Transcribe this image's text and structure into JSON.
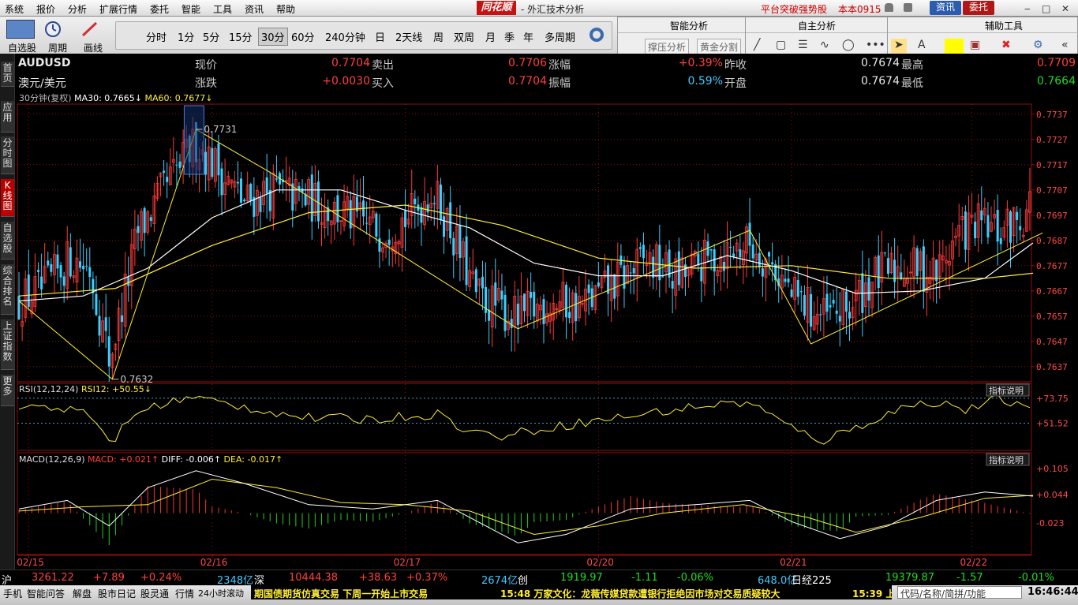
{
  "menubar": {
    "items": [
      "系统",
      "报价",
      "分析",
      "扩展行情",
      "委托",
      "智能",
      "工具",
      "资讯",
      "帮助"
    ],
    "logo": "同花顺",
    "app_title": "- 外汇技术分析",
    "promo": "平台突破强势股",
    "version": "本本0915",
    "news_btn": "资讯",
    "trade_btn": "委托"
  },
  "toolbar": {
    "groups": [
      "自选股",
      "周期",
      "画线"
    ],
    "periods": [
      "分时",
      "1分",
      "5分",
      "15分",
      "30分",
      "60分",
      "240分钟",
      "日",
      "2天线",
      "周",
      "双周",
      "月",
      "季",
      "年",
      "多周期"
    ],
    "selected_period": "30分"
  },
  "analysis_panel": {
    "headers": [
      "智能分析",
      "自主分析",
      "辅助工具"
    ],
    "buttons": [
      "撑压分析",
      "黄金分割"
    ]
  },
  "left_tabs": [
    {
      "label": "首页",
      "active": false
    },
    {
      "label": "应用",
      "active": false
    },
    {
      "label": "分时图",
      "active": false
    },
    {
      "label": "K线图",
      "active": true
    },
    {
      "label": "自选股",
      "active": false
    },
    {
      "label": "综合排名",
      "active": false
    },
    {
      "label": "上证指数",
      "active": false
    },
    {
      "label": "更多",
      "active": false
    }
  ],
  "quote": {
    "symbol": "AUDUSD",
    "name": "澳元/美元",
    "fields": [
      {
        "label": "现价",
        "value": "0.7704",
        "color": "red"
      },
      {
        "label": "涨跌",
        "value": "+0.0030",
        "color": "red"
      },
      {
        "label": "卖出",
        "value": "0.7706",
        "color": "red"
      },
      {
        "label": "买入",
        "value": "0.7704",
        "color": "red"
      },
      {
        "label": "涨幅",
        "value": "+0.39%",
        "color": "red"
      },
      {
        "label": "振幅",
        "value": "0.59%",
        "color": "cyn"
      },
      {
        "label": "昨收",
        "value": "0.7674",
        "color": "w"
      },
      {
        "label": "开盘",
        "value": "0.7674",
        "color": "w"
      },
      {
        "label": "最高",
        "value": "0.7709",
        "color": "red"
      },
      {
        "label": "最低",
        "value": "0.7664",
        "color": "grn"
      }
    ]
  },
  "chart_data": {
    "type": "candlestick",
    "period_label": "30分钟(复权)",
    "ma_legend": [
      {
        "label": "MA30: 0.7665",
        "color": "#ffffff"
      },
      {
        "label": "MA60: 0.7677",
        "color": "#ffee33"
      }
    ],
    "y_ticks": [
      0.7737,
      0.7727,
      0.7717,
      0.7707,
      0.7697,
      0.7687,
      0.7677,
      0.7667,
      0.7657,
      0.7647,
      0.7637
    ],
    "ylim": [
      0.7631,
      0.7741
    ],
    "x_labels": [
      {
        "label": "02/15",
        "index": 3
      },
      {
        "label": "02/16",
        "index": 60
      },
      {
        "label": "02/17",
        "index": 120
      },
      {
        "label": "02/20",
        "index": 180
      },
      {
        "label": "02/21",
        "index": 240
      },
      {
        "label": "02/22",
        "index": 296
      }
    ],
    "bar_count": 315,
    "high_annotation": {
      "label": "0.7731",
      "value": 0.7731,
      "index": 55
    },
    "low_annotation": {
      "label": "0.7632",
      "value": 0.7632,
      "index": 29
    },
    "zigzag": [
      {
        "i": 0,
        "v": 0.7663
      },
      {
        "i": 29,
        "v": 0.7632
      },
      {
        "i": 55,
        "v": 0.7731
      },
      {
        "i": 78,
        "v": 0.7714
      },
      {
        "i": 155,
        "v": 0.7652
      },
      {
        "i": 227,
        "v": 0.7691
      },
      {
        "i": 246,
        "v": 0.7646
      },
      {
        "i": 318,
        "v": 0.769
      }
    ],
    "close_path": [
      {
        "i": 0,
        "v": 0.7663
      },
      {
        "i": 8,
        "v": 0.7668
      },
      {
        "i": 16,
        "v": 0.768
      },
      {
        "i": 22,
        "v": 0.7676
      },
      {
        "i": 28,
        "v": 0.764
      },
      {
        "i": 31,
        "v": 0.7655
      },
      {
        "i": 37,
        "v": 0.769
      },
      {
        "i": 45,
        "v": 0.7707
      },
      {
        "i": 52,
        "v": 0.772
      },
      {
        "i": 55,
        "v": 0.7726
      },
      {
        "i": 62,
        "v": 0.7715
      },
      {
        "i": 70,
        "v": 0.7702
      },
      {
        "i": 78,
        "v": 0.7707
      },
      {
        "i": 90,
        "v": 0.7703
      },
      {
        "i": 100,
        "v": 0.7698
      },
      {
        "i": 112,
        "v": 0.7691
      },
      {
        "i": 122,
        "v": 0.7697
      },
      {
        "i": 128,
        "v": 0.7707
      },
      {
        "i": 133,
        "v": 0.7695
      },
      {
        "i": 142,
        "v": 0.7665
      },
      {
        "i": 155,
        "v": 0.7656
      },
      {
        "i": 165,
        "v": 0.7663
      },
      {
        "i": 175,
        "v": 0.7661
      },
      {
        "i": 185,
        "v": 0.767
      },
      {
        "i": 195,
        "v": 0.7679
      },
      {
        "i": 205,
        "v": 0.7672
      },
      {
        "i": 215,
        "v": 0.768
      },
      {
        "i": 227,
        "v": 0.7686
      },
      {
        "i": 235,
        "v": 0.7676
      },
      {
        "i": 240,
        "v": 0.7665
      },
      {
        "i": 250,
        "v": 0.7656
      },
      {
        "i": 258,
        "v": 0.766
      },
      {
        "i": 265,
        "v": 0.7672
      },
      {
        "i": 275,
        "v": 0.7677
      },
      {
        "i": 285,
        "v": 0.7674
      },
      {
        "i": 292,
        "v": 0.769
      },
      {
        "i": 298,
        "v": 0.7693
      },
      {
        "i": 305,
        "v": 0.769
      },
      {
        "i": 312,
        "v": 0.7697
      },
      {
        "i": 315,
        "v": 0.7704
      }
    ],
    "ma30_path": [
      {
        "i": 0,
        "v": 0.7663
      },
      {
        "i": 20,
        "v": 0.7665
      },
      {
        "i": 40,
        "v": 0.7676
      },
      {
        "i": 60,
        "v": 0.7696
      },
      {
        "i": 80,
        "v": 0.7707
      },
      {
        "i": 100,
        "v": 0.7707
      },
      {
        "i": 120,
        "v": 0.7699
      },
      {
        "i": 140,
        "v": 0.7692
      },
      {
        "i": 160,
        "v": 0.7678
      },
      {
        "i": 180,
        "v": 0.7673
      },
      {
        "i": 200,
        "v": 0.7673
      },
      {
        "i": 220,
        "v": 0.7681
      },
      {
        "i": 240,
        "v": 0.7675
      },
      {
        "i": 260,
        "v": 0.7666
      },
      {
        "i": 280,
        "v": 0.7667
      },
      {
        "i": 300,
        "v": 0.7672
      },
      {
        "i": 315,
        "v": 0.7686
      }
    ],
    "ma60_path": [
      {
        "i": 0,
        "v": 0.7665
      },
      {
        "i": 30,
        "v": 0.7668
      },
      {
        "i": 60,
        "v": 0.7685
      },
      {
        "i": 90,
        "v": 0.7698
      },
      {
        "i": 120,
        "v": 0.7701
      },
      {
        "i": 150,
        "v": 0.7693
      },
      {
        "i": 180,
        "v": 0.768
      },
      {
        "i": 210,
        "v": 0.7676
      },
      {
        "i": 240,
        "v": 0.7677
      },
      {
        "i": 270,
        "v": 0.7672
      },
      {
        "i": 300,
        "v": 0.7672
      },
      {
        "i": 315,
        "v": 0.7674
      }
    ],
    "rsi": {
      "legend": [
        {
          "label": "RSI(12,12,24)",
          "color": "#dddddd"
        },
        {
          "label": "RSI12: +50.55",
          "color": "#ffee33"
        }
      ],
      "button": "指标说明",
      "ticks": [
        73.75,
        51.52
      ],
      "ylim": [
        30,
        80
      ],
      "path": [
        {
          "i": 0,
          "v": 66
        },
        {
          "i": 10,
          "v": 67
        },
        {
          "i": 20,
          "v": 60
        },
        {
          "i": 26,
          "v": 45
        },
        {
          "i": 29,
          "v": 34
        },
        {
          "i": 35,
          "v": 58
        },
        {
          "i": 45,
          "v": 70
        },
        {
          "i": 55,
          "v": 74
        },
        {
          "i": 70,
          "v": 66
        },
        {
          "i": 90,
          "v": 56
        },
        {
          "i": 110,
          "v": 55
        },
        {
          "i": 130,
          "v": 60
        },
        {
          "i": 140,
          "v": 44
        },
        {
          "i": 150,
          "v": 40
        },
        {
          "i": 165,
          "v": 48
        },
        {
          "i": 180,
          "v": 54
        },
        {
          "i": 200,
          "v": 62
        },
        {
          "i": 215,
          "v": 68
        },
        {
          "i": 227,
          "v": 70
        },
        {
          "i": 240,
          "v": 47
        },
        {
          "i": 250,
          "v": 36
        },
        {
          "i": 260,
          "v": 48
        },
        {
          "i": 275,
          "v": 66
        },
        {
          "i": 285,
          "v": 71
        },
        {
          "i": 295,
          "v": 63
        },
        {
          "i": 305,
          "v": 74
        },
        {
          "i": 315,
          "v": 60
        }
      ]
    },
    "macd": {
      "legend": [
        {
          "label": "MACD(12,26,9)",
          "color": "#dddddd"
        },
        {
          "label": "MACD: +0.021",
          "color": "#ff4040"
        },
        {
          "label": "DIFF: -0.006",
          "color": "#ffffff"
        },
        {
          "label": "DEA: -0.017",
          "color": "#ffee33"
        }
      ],
      "button": "指标说明",
      "ticks": [
        0.105,
        0.044,
        -0.023
      ],
      "ylim": [
        -0.09,
        0.12
      ],
      "diff_path": [
        {
          "i": 0,
          "v": 0.01
        },
        {
          "i": 15,
          "v": 0.03
        },
        {
          "i": 28,
          "v": -0.03
        },
        {
          "i": 40,
          "v": 0.06
        },
        {
          "i": 55,
          "v": 0.1
        },
        {
          "i": 70,
          "v": 0.07
        },
        {
          "i": 90,
          "v": 0.02
        },
        {
          "i": 110,
          "v": 0.01
        },
        {
          "i": 130,
          "v": 0.03
        },
        {
          "i": 145,
          "v": -0.03
        },
        {
          "i": 155,
          "v": -0.07
        },
        {
          "i": 170,
          "v": -0.05
        },
        {
          "i": 190,
          "v": 0.01
        },
        {
          "i": 210,
          "v": 0.02
        },
        {
          "i": 227,
          "v": 0.03
        },
        {
          "i": 240,
          "v": -0.02
        },
        {
          "i": 255,
          "v": -0.06
        },
        {
          "i": 270,
          "v": -0.03
        },
        {
          "i": 285,
          "v": 0.03
        },
        {
          "i": 300,
          "v": 0.05
        },
        {
          "i": 315,
          "v": 0.04
        }
      ],
      "dea_path": [
        {
          "i": 0,
          "v": 0.005
        },
        {
          "i": 20,
          "v": 0.015
        },
        {
          "i": 40,
          "v": 0.02
        },
        {
          "i": 60,
          "v": 0.08
        },
        {
          "i": 80,
          "v": 0.06
        },
        {
          "i": 100,
          "v": 0.025
        },
        {
          "i": 120,
          "v": 0.02
        },
        {
          "i": 140,
          "v": 0.005
        },
        {
          "i": 160,
          "v": -0.05
        },
        {
          "i": 180,
          "v": -0.03
        },
        {
          "i": 200,
          "v": 0.0
        },
        {
          "i": 225,
          "v": 0.02
        },
        {
          "i": 245,
          "v": -0.01
        },
        {
          "i": 260,
          "v": -0.045
        },
        {
          "i": 280,
          "v": -0.01
        },
        {
          "i": 300,
          "v": 0.035
        },
        {
          "i": 315,
          "v": 0.042
        }
      ]
    }
  },
  "statusbar": {
    "items": [
      {
        "text": "沪",
        "color": "#ffffff"
      },
      {
        "text": "3261.22",
        "color": "#ff4040"
      },
      {
        "text": "+7.89",
        "color": "#ff4040"
      },
      {
        "text": "+0.24%",
        "color": "#ff4040"
      },
      {
        "text": "2348亿",
        "color": "#40c8ff"
      },
      {
        "text": "深",
        "color": "#ffffff"
      },
      {
        "text": "10444.38",
        "color": "#ff4040"
      },
      {
        "text": "+38.63",
        "color": "#ff4040"
      },
      {
        "text": "+0.37%",
        "color": "#ff4040"
      },
      {
        "text": "2674亿",
        "color": "#40c8ff"
      },
      {
        "text": "创",
        "color": "#ffffff"
      },
      {
        "text": "1919.97",
        "color": "#20dd20"
      },
      {
        "text": "-1.11",
        "color": "#20dd20"
      },
      {
        "text": "-0.06%",
        "color": "#20dd20"
      },
      {
        "text": "648.0亿",
        "color": "#40c8ff"
      },
      {
        "text": "日经225",
        "color": "#ffffff"
      },
      {
        "text": "19379.87",
        "color": "#20dd20"
      },
      {
        "text": "-1.57",
        "color": "#20dd20"
      },
      {
        "text": "-0.01%",
        "color": "#20dd20"
      }
    ]
  },
  "bottombar": {
    "tabs": [
      "手机",
      "智能问答",
      "解盘",
      "股市日记",
      "股灵通",
      "行情",
      "24小时滚动"
    ],
    "ticker1": "期国债期货仿真交易 下周一开始上市交易",
    "ticker2": "15:48 万家文化：龙薇传媒贷款遭银行拒绝因市场对交易质疑较大",
    "ticker3": "15:39 上",
    "search_placeholder": "代码/名称/简拼/功能",
    "clock": "16:46:44"
  },
  "colors": {
    "up": "#ff3a3a",
    "down": "#38d0ff",
    "ma30": "#ffffff",
    "ma60": "#ffee33",
    "zigzag": "#ffee33",
    "grid": "#8a1010"
  }
}
